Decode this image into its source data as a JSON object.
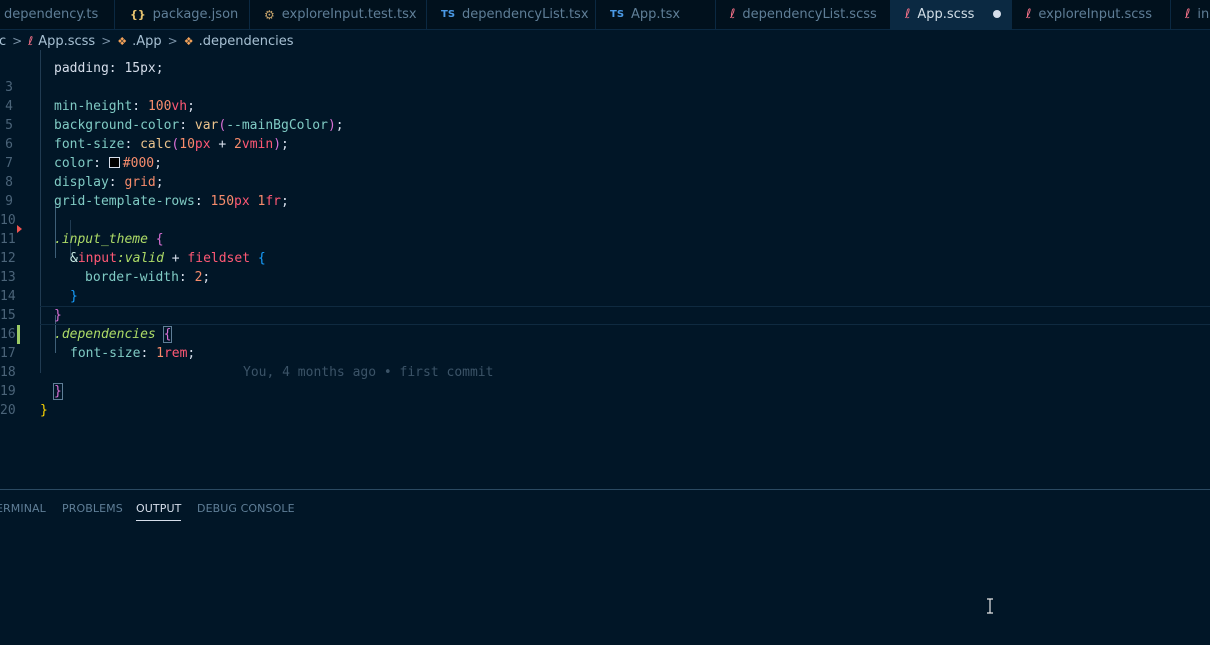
{
  "tabs": [
    {
      "label": "dependency.ts",
      "icon": "",
      "icon_name": "none",
      "active": false
    },
    {
      "label": "package.json",
      "icon": "{}",
      "icon_name": "json-icon",
      "active": false
    },
    {
      "label": "exploreInput.test.tsx",
      "icon": "⚙",
      "icon_name": "test-icon",
      "active": false
    },
    {
      "label": "dependencyList.tsx",
      "icon": "TS",
      "icon_name": "typescript-icon",
      "active": false
    },
    {
      "label": "App.tsx",
      "icon": "TS",
      "icon_name": "typescript-icon",
      "active": false
    },
    {
      "label": "dependencyList.scss",
      "icon": "ℓ",
      "icon_name": "sass-icon",
      "active": false
    },
    {
      "label": "App.scss",
      "icon": "ℓ",
      "icon_name": "sass-icon",
      "active": true,
      "modified": true
    },
    {
      "label": "exploreInput.scss",
      "icon": "ℓ",
      "icon_name": "sass-icon",
      "active": false
    },
    {
      "label": "in",
      "icon": "ℓ",
      "icon_name": "sass-icon",
      "active": false
    }
  ],
  "breadcrumb": {
    "prefix": "c",
    "file": "App.scss",
    "parent": ".App",
    "current": ".dependencies",
    "separator": ">"
  },
  "editor": {
    "partial_top": "padding: 15px;",
    "lines": [
      {
        "n": "3",
        "prop": "min-height",
        "val": "100",
        "unit": "vh"
      },
      {
        "n": "4",
        "prop": "background-color",
        "func": "var",
        "arg": "--mainBgColor"
      },
      {
        "n": "5",
        "prop": "font-size",
        "func": "calc",
        "a": "10",
        "au": "px",
        "op": "+",
        "b": "2",
        "bu": "vmin"
      },
      {
        "n": "6",
        "prop": "color",
        "val": "#000"
      },
      {
        "n": "7",
        "prop": "display",
        "val": "grid"
      },
      {
        "n": "8",
        "prop": "grid-template-rows",
        "a": "150",
        "au": "px",
        "b": "1",
        "bu": "fr"
      },
      {
        "n": "9"
      },
      {
        "n": "10",
        "selector": ".input_theme"
      },
      {
        "n": "11",
        "amp": "&",
        "tag": "input",
        "pseudo": ":valid",
        "comb": "+",
        "tag2": "fieldset"
      },
      {
        "n": "12",
        "prop": "border-width",
        "val": "2"
      },
      {
        "n": "13"
      },
      {
        "n": "14"
      },
      {
        "n": "15",
        "selector": ".dependencies"
      },
      {
        "n": "16",
        "prop": "font-size",
        "val": "1",
        "unit": "rem",
        "blame": "You, 4 months ago • first commit"
      },
      {
        "n": "17"
      },
      {
        "n": "18"
      },
      {
        "n": "19"
      },
      {
        "n": "20"
      }
    ],
    "punct": {
      "colon": ":",
      "semi": ";",
      "open": "{",
      "close": "}",
      "lparen": "(",
      "rparen": ")",
      "comma": ","
    },
    "accent_colors": {
      "modified": "#9ccc65",
      "deleted": "#ef5350"
    }
  },
  "panel": {
    "tabs": [
      {
        "label": "ERMINAL",
        "active": false
      },
      {
        "label": "PROBLEMS",
        "active": false
      },
      {
        "label": "OUTPUT",
        "active": true
      },
      {
        "label": "DEBUG CONSOLE",
        "active": false
      }
    ]
  },
  "theme": {
    "background": "#011627",
    "tab_active": "#0b2942"
  }
}
